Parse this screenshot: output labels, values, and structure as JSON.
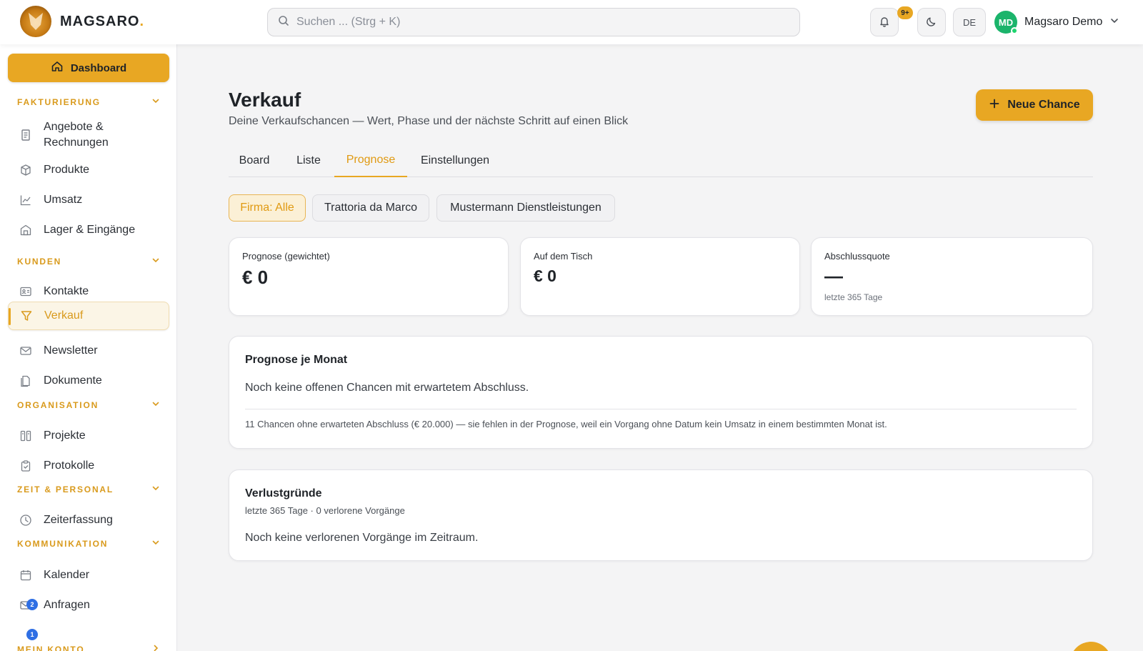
{
  "app": {
    "brand": "MAGSARO",
    "brand_dot": ".",
    "accent_color": "#e8a723"
  },
  "topbar": {
    "search_placeholder": "Suchen ... (Strg + K)",
    "notifications_badge": "9+",
    "language": "DE",
    "user_initials": "MD",
    "user_name": "Magsaro Demo"
  },
  "sidebar": {
    "dashboard": "Dashboard",
    "sections": {
      "fakturierung": "FAKTURIERUNG",
      "kunden": "KUNDEN",
      "organisation": "ORGANISATION",
      "zeit": "ZEIT & PERSONAL",
      "kommunikation": "KOMMUNIKATION",
      "konto": "MEIN KONTO"
    },
    "items": {
      "angebote_line1": "Angebote &",
      "angebote_line2": "Rechnungen",
      "produkte": "Produkte",
      "umsatz": "Umsatz",
      "lager": "Lager & Eingänge",
      "kontakte": "Kontakte",
      "verkauf": "Verkauf",
      "newsletter": "Newsletter",
      "dokumente": "Dokumente",
      "projekte": "Projekte",
      "protokolle": "Protokolle",
      "zeiterfassung": "Zeiterfassung",
      "kalender": "Kalender",
      "anfragen": "Anfragen"
    },
    "anfragen_badge": "2",
    "konto_badge": "1"
  },
  "page": {
    "title": "Verkauf",
    "subtitle": "Deine Verkaufschancen — Wert, Phase und der nächste Schritt auf einen Blick",
    "new_button": "Neue Chance",
    "tabs": [
      "Board",
      "Liste",
      "Prognose",
      "Einstellungen"
    ],
    "active_tab": "Prognose",
    "filters": [
      "Firma: Alle",
      "Trattoria da Marco",
      "Mustermann Dienstleistungen"
    ],
    "active_filter": "Firma: Alle"
  },
  "kpis": [
    {
      "label": "Prognose (gewichtet)",
      "value": "€ 0",
      "sub": ""
    },
    {
      "label": "Auf dem Tisch",
      "value": "€ 0",
      "sub": ""
    },
    {
      "label": "Abschlussquote",
      "value": "—",
      "sub": "letzte 365 Tage"
    }
  ],
  "forecast_card": {
    "title": "Prognose je Monat",
    "empty": "Noch keine offenen Chancen mit erwartetem Abschluss.",
    "note": "11 Chancen ohne erwarteten Abschluss (€ 20.000) — sie fehlen in der Prognose, weil ein Vorgang ohne Datum kein Umsatz in einem bestimmten Monat ist."
  },
  "loss_card": {
    "title": "Verlustgründe",
    "meta": "letzte 365 Tage · 0 verlorene Vorgänge",
    "empty": "Noch keine verlorenen Vorgänge im Zeitraum."
  }
}
